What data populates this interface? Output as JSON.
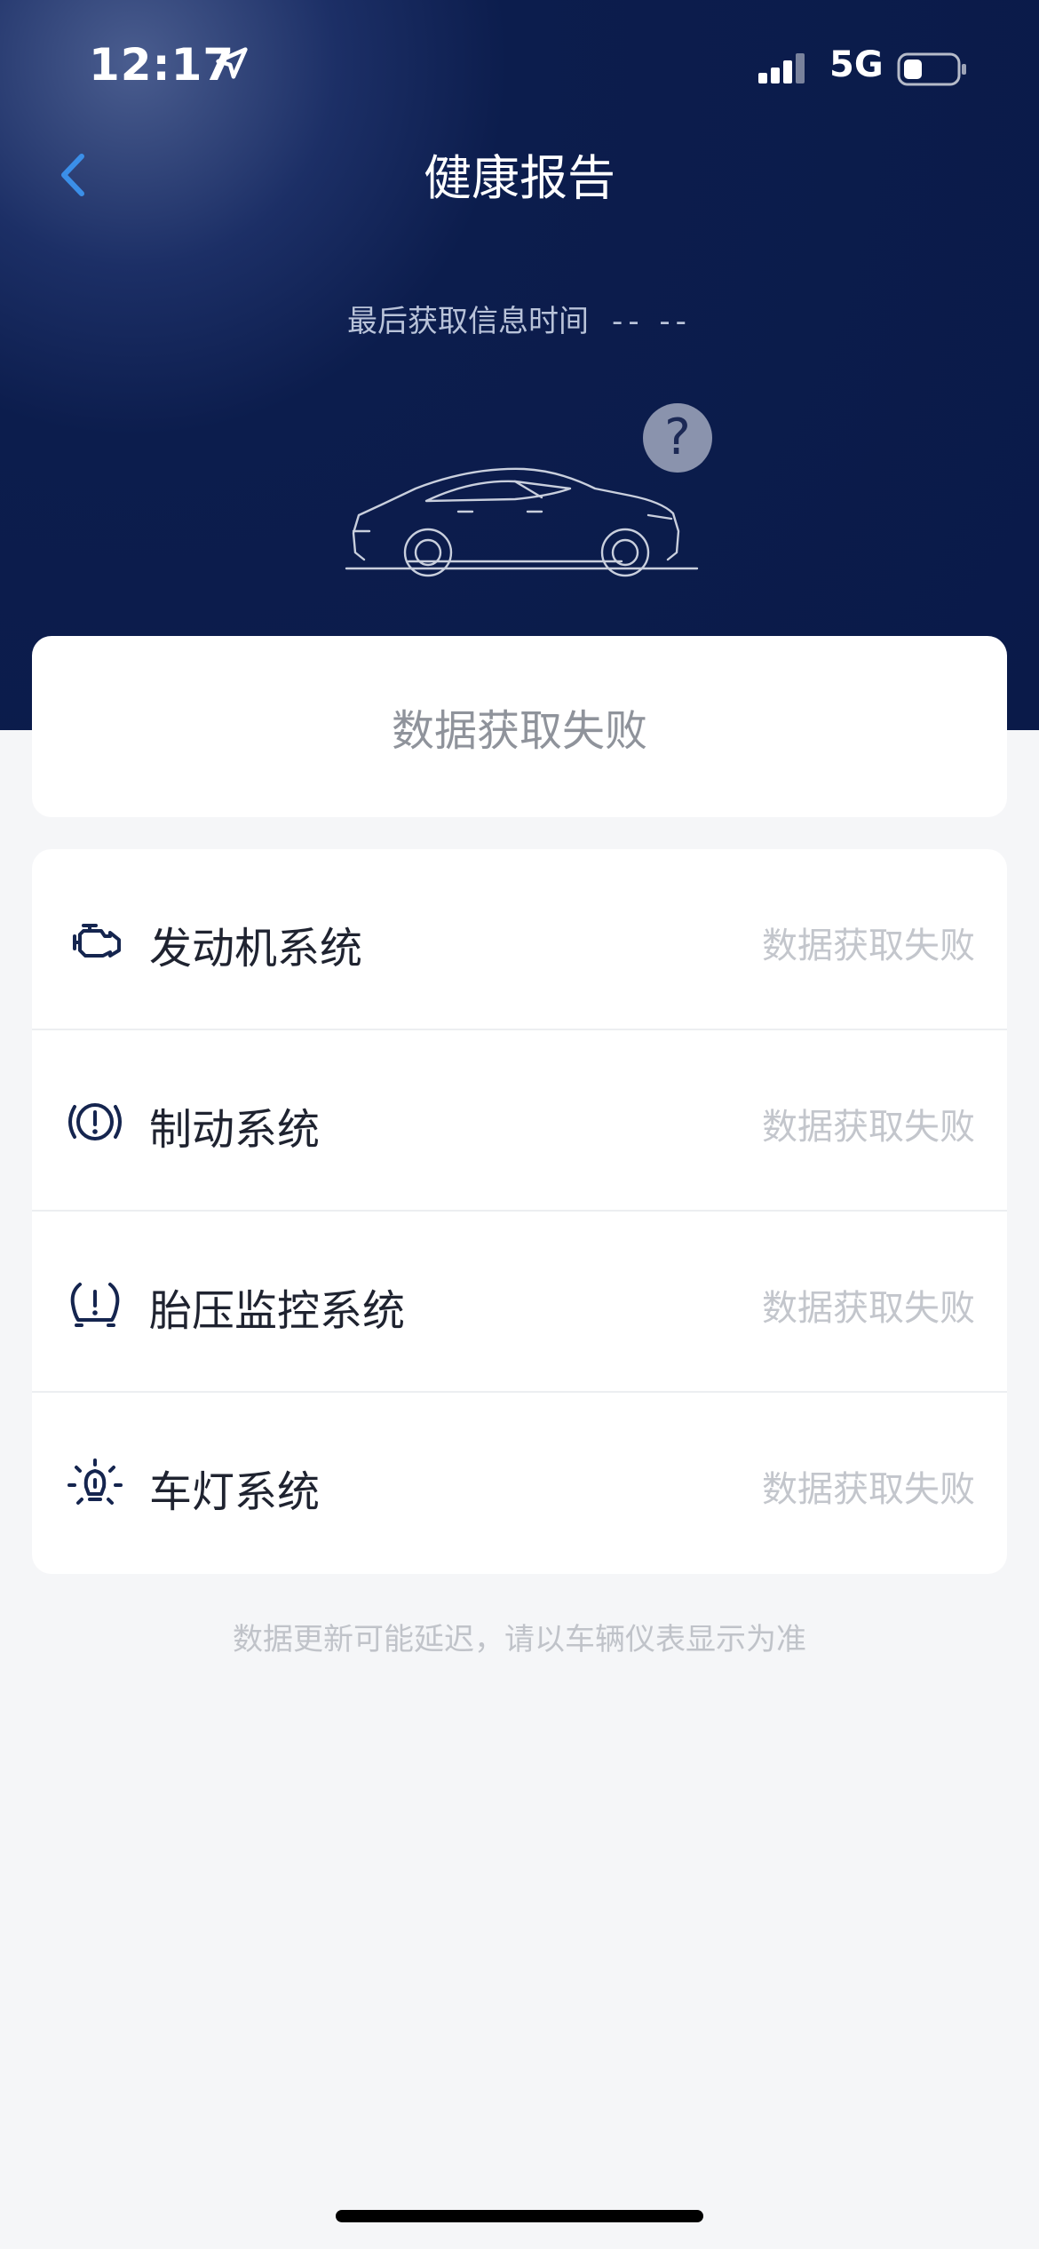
{
  "status_bar": {
    "time": "12:17",
    "network": "5G"
  },
  "header": {
    "title": "健康报告",
    "last_fetch_label": "最后获取信息时间",
    "last_fetch_value": "-- --",
    "help_symbol": "?"
  },
  "summary": {
    "message": "数据获取失败"
  },
  "systems": [
    {
      "name": "发动机系统",
      "status": "数据获取失败",
      "icon": "engine-icon"
    },
    {
      "name": "制动系统",
      "status": "数据获取失败",
      "icon": "brake-warning-icon"
    },
    {
      "name": "胎压监控系统",
      "status": "数据获取失败",
      "icon": "tire-pressure-icon"
    },
    {
      "name": "车灯系统",
      "status": "数据获取失败",
      "icon": "light-bulb-icon"
    }
  ],
  "footnote": "数据更新可能延迟，请以车辆仪表显示为准",
  "colors": {
    "header_bg": "#0a1a49",
    "back_arrow": "#3b8fe8",
    "icon": "#15254f",
    "page_bg": "#f5f6f8"
  }
}
